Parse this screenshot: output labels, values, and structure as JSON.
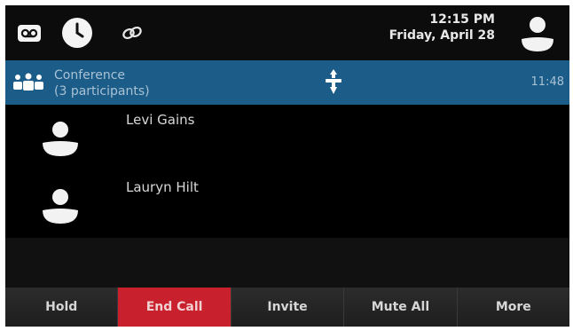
{
  "status_bar": {
    "time": "12:15 PM",
    "date": "Friday, April 28",
    "icons": [
      "voicemail-icon",
      "clock-icon",
      "link-icon",
      "user-status-icon"
    ]
  },
  "conference": {
    "title": "Conference",
    "participants_label": "(3 participants)",
    "duration": "11:48",
    "icons": [
      "group-icon",
      "signal-icon"
    ],
    "color": "#1b5c88"
  },
  "participants": [
    {
      "name": "Levi Gains",
      "icon": "avatar-icon"
    },
    {
      "name": "Lauryn Hilt",
      "icon": "avatar-icon"
    }
  ],
  "softkeys": [
    {
      "label": "Hold"
    },
    {
      "label": "End Call",
      "color": "#c8202c"
    },
    {
      "label": "Invite"
    },
    {
      "label": "Mute All"
    },
    {
      "label": "More"
    }
  ]
}
